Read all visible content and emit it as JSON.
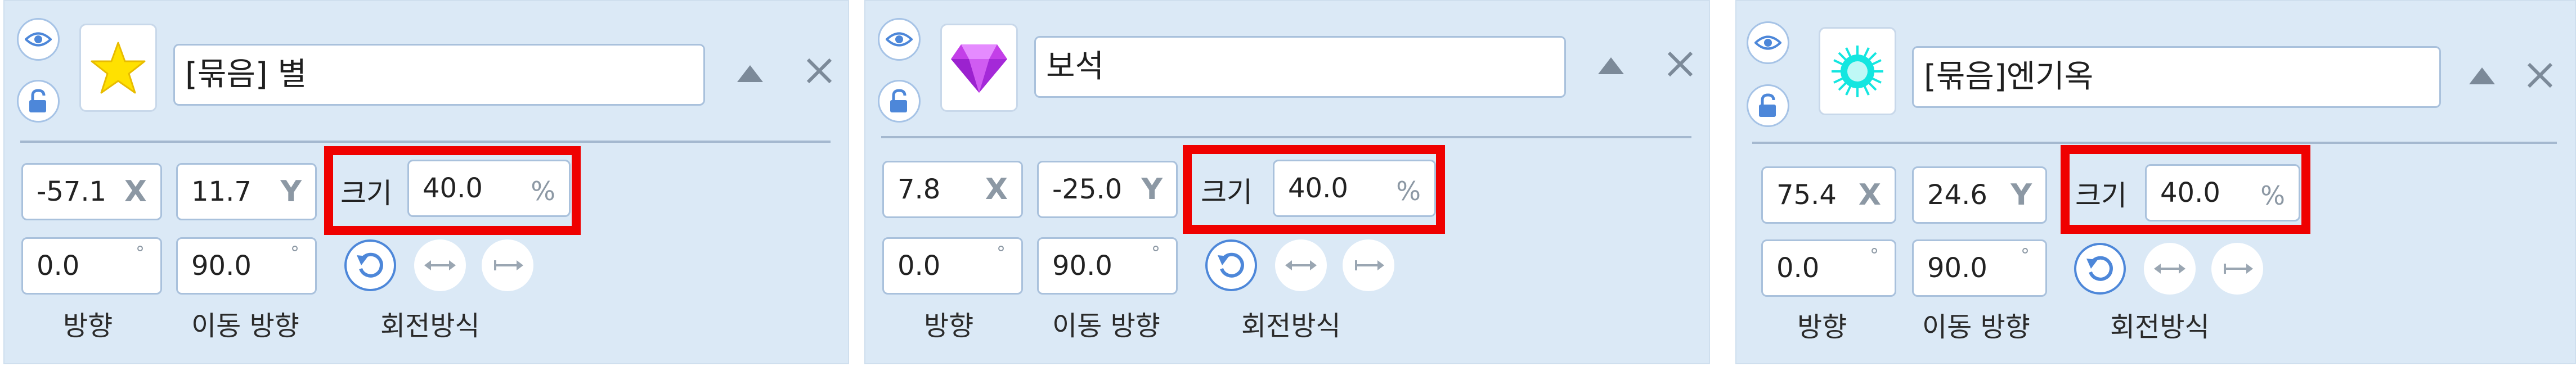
{
  "panels": [
    {
      "name": "[묶음] 별",
      "thumbnail_icon": "star-icon",
      "x": "-57.1",
      "x_unit": "X",
      "y": "11.7",
      "y_unit": "Y",
      "size_label": "크기",
      "size": "40.0",
      "size_unit": "%",
      "direction": "0.0",
      "move_direction": "90.0",
      "degree_symbol": "°",
      "direction_label": "방향",
      "move_direction_label": "이동 방향",
      "rotation_label": "회전방식"
    },
    {
      "name": "보석",
      "thumbnail_icon": "gem-icon",
      "x": "7.8",
      "x_unit": "X",
      "y": "-25.0",
      "y_unit": "Y",
      "size_label": "크기",
      "size": "40.0",
      "size_unit": "%",
      "direction": "0.0",
      "move_direction": "90.0",
      "degree_symbol": "°",
      "direction_label": "방향",
      "move_direction_label": "이동 방향",
      "rotation_label": "회전방식"
    },
    {
      "name": "[묶음]엔기옥",
      "thumbnail_icon": "energy-orb-icon",
      "x": "75.4",
      "x_unit": "X",
      "y": "24.6",
      "y_unit": "Y",
      "size_label": "크기",
      "size": "40.0",
      "size_unit": "%",
      "direction": "0.0",
      "move_direction": "90.0",
      "degree_symbol": "°",
      "direction_label": "방향",
      "move_direction_label": "이동 방향",
      "rotation_label": "회전방식"
    }
  ],
  "colors": {
    "panel_bg": "#dbe9f6",
    "highlight": "#ef0000",
    "accent_blue": "#4d87d9",
    "star_yellow": "#ffe100",
    "gem_purple": "#b02ee0",
    "orb_cyan": "#14e6e0"
  }
}
